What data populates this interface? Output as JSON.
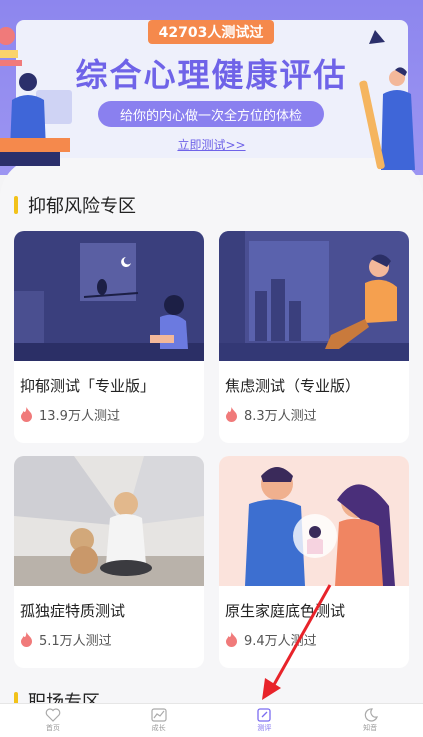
{
  "banner": {
    "test_count": "42703人测试过",
    "title": "综合心理健康评估",
    "subtitle": "给你的内心做一次全方位的体检",
    "cta": "立即测试>>"
  },
  "sections": {
    "depression": {
      "title": "抑郁风险专区"
    },
    "workplace": {
      "title": "职场专区"
    }
  },
  "cards": [
    {
      "name": "抑郁测试「专业版」",
      "count": "13.9万人测过"
    },
    {
      "name": "焦虑测试（专业版）",
      "count": "8.3万人测过"
    },
    {
      "name": "孤独症特质测试",
      "count": "5.1万人测过"
    },
    {
      "name": "原生家庭底色测试",
      "count": "9.4万人测过"
    }
  ],
  "tabs": [
    {
      "label": "首页",
      "icon": "heart-icon"
    },
    {
      "label": "成长",
      "icon": "chart-icon"
    },
    {
      "label": "测评",
      "icon": "edit-icon"
    },
    {
      "label": "知音",
      "icon": "moon-icon"
    }
  ],
  "colors": {
    "accent": "#7b6cf0",
    "banner": "#8d86ee",
    "pill": "#f5894c",
    "flame": "#f07a7a",
    "section_bar": "#f2c21a",
    "arrow": "#e8232a"
  }
}
